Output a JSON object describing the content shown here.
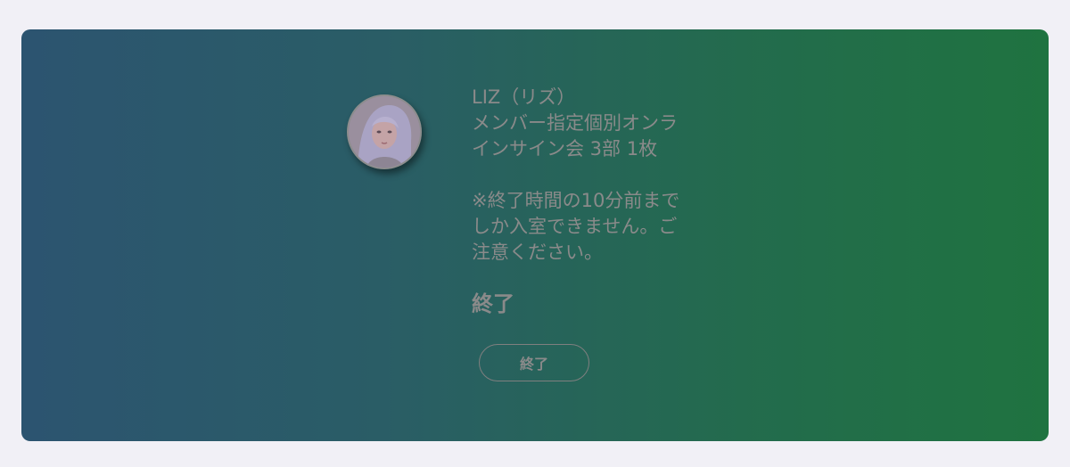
{
  "event": {
    "member": "LIZ（リズ）",
    "title_line1": "メンバー指定個別オンラ",
    "title_line2": "インサイン会 3部 1枚",
    "notice_line1": "※終了時間の10分前まで",
    "notice_line2": "しか入室できません。ご",
    "notice_line3": "注意ください。"
  },
  "status": {
    "label": "終了",
    "button_label": "終了"
  },
  "colors": {
    "gradient_start": "#2c5470",
    "gradient_end": "#1f7340",
    "text_muted": "#8a8a8a",
    "page_bg": "#f1f0f6"
  },
  "icons": {
    "avatar": "member-photo"
  }
}
